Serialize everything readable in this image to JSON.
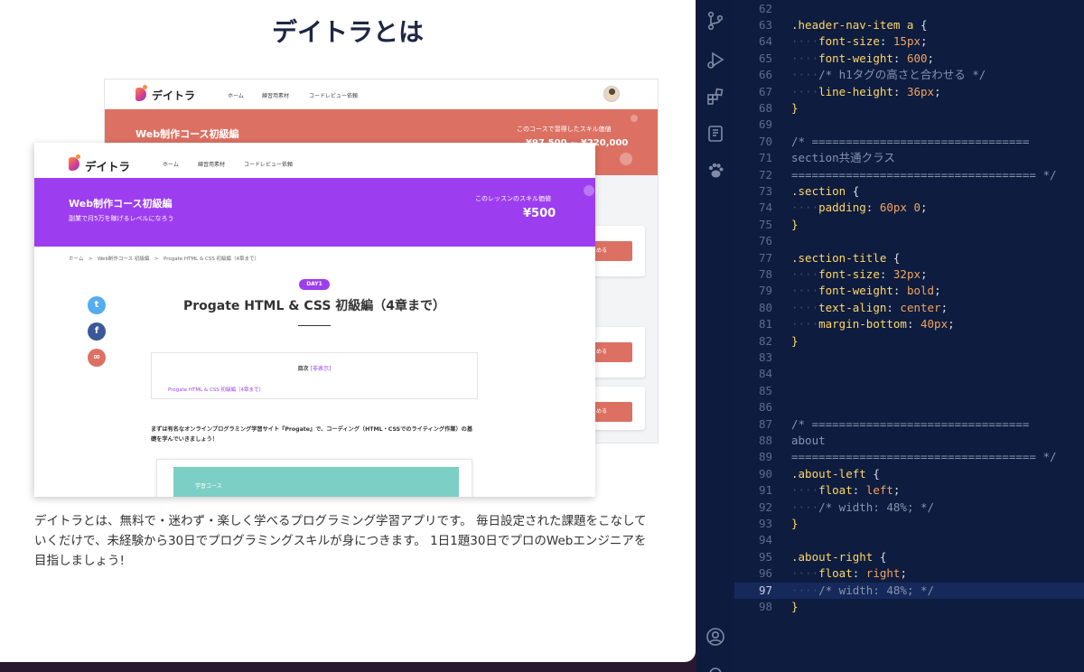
{
  "preview": {
    "title": "デイトラとは",
    "about_text": "デイトラとは、無料で・迷わず・楽しく学べるプログラミング学習アプリです。 毎日設定された課題をこなしていくだけで、未経験から30日でプログラミングスキルが身につきます。 1日1題30日でプロのWebエンジニアを目指しましょう!",
    "back_shot": {
      "logo": "デイトラ",
      "nav": [
        "ホーム",
        "練習用素材",
        "コードレビュー依頼"
      ],
      "banner_title": "Web制作コース初級編",
      "banner_right": "このコースで習得したスキル価値",
      "banner_price": "¥97,500 ~ ¥220,000",
      "card_buttons": [
        "める",
        "める",
        "める"
      ]
    },
    "front_shot": {
      "logo": "デイトラ",
      "nav": [
        "ホーム",
        "練習用素材",
        "コードレビュー依頼"
      ],
      "banner_title": "Web制作コース初級編",
      "banner_subtitle": "副業で月5万を稼げるレベルになろう",
      "banner_right": "このレッスンのスキル価値",
      "banner_price": "¥500",
      "breadcrumb": "ホーム　>　Web制作コース 初級編　>　Progate HTML & CSS 初級編（4章まで）",
      "day_badge": "DAY1",
      "article_title": "Progate HTML & CSS 初級編（4章まで）",
      "toc_title": "目次",
      "toc_toggle": "[非表示]",
      "toc_item": "Progate HTML & CSS 初級編（4章まで）",
      "intro": "まずは有名なオンラインプログラミング学習サイト『Progate』で、コーディング（HTML・CSSでのライティング作業）の基礎を学んでいきましょう！",
      "course_label": "学習コース"
    }
  },
  "activity_bar": [
    "source-control-icon",
    "run-debug-icon",
    "extensions-icon",
    "notebook-icon",
    "paw-icon",
    "account-icon"
  ],
  "editor": {
    "active_line": 97,
    "lines": [
      {
        "n": "62",
        "text": ""
      },
      {
        "n": "63",
        "text": ".header-nav-item a {"
      },
      {
        "n": "64",
        "text": "····font-size: 15px;"
      },
      {
        "n": "65",
        "text": "····font-weight: 600;"
      },
      {
        "n": "66",
        "text": "····/* h1タグの高さと合わせる */"
      },
      {
        "n": "67",
        "text": "····line-height: 36px;"
      },
      {
        "n": "68",
        "text": "}"
      },
      {
        "n": "69",
        "text": ""
      },
      {
        "n": "70",
        "text": "/* ================================"
      },
      {
        "n": "71",
        "text": "section共通クラス"
      },
      {
        "n": "72",
        "text": "==================================== */"
      },
      {
        "n": "73",
        "text": ".section {"
      },
      {
        "n": "74",
        "text": "····padding: 60px 0;"
      },
      {
        "n": "75",
        "text": "}"
      },
      {
        "n": "76",
        "text": ""
      },
      {
        "n": "77",
        "text": ".section-title {"
      },
      {
        "n": "78",
        "text": "····font-size: 32px;"
      },
      {
        "n": "79",
        "text": "····font-weight: bold;"
      },
      {
        "n": "80",
        "text": "····text-align: center;"
      },
      {
        "n": "81",
        "text": "····margin-bottom: 40px;"
      },
      {
        "n": "82",
        "text": "}"
      },
      {
        "n": "83",
        "text": ""
      },
      {
        "n": "84",
        "text": ""
      },
      {
        "n": "85",
        "text": ""
      },
      {
        "n": "86",
        "text": ""
      },
      {
        "n": "87",
        "text": "/* ================================"
      },
      {
        "n": "88",
        "text": "about"
      },
      {
        "n": "89",
        "text": "==================================== */"
      },
      {
        "n": "90",
        "text": ".about-left {"
      },
      {
        "n": "91",
        "text": "····float: left;"
      },
      {
        "n": "92",
        "text": "····/* width: 48%; */"
      },
      {
        "n": "93",
        "text": "}"
      },
      {
        "n": "94",
        "text": ""
      },
      {
        "n": "95",
        "text": ".about-right {"
      },
      {
        "n": "96",
        "text": "····float: right;"
      },
      {
        "n": "97",
        "text": "····/* width: 48%; */"
      },
      {
        "n": "98",
        "text": "}"
      }
    ]
  },
  "colors": {
    "editor_bg": "#0e1c3f",
    "selector": "#ffd866",
    "value": "#f2a35e",
    "comment": "#8792b0",
    "brand_purple": "#9d3df0",
    "brand_coral": "#dc7163"
  }
}
